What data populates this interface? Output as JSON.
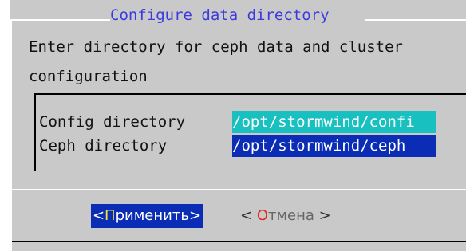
{
  "dialog": {
    "title": "Configure data directory",
    "prompt": "Enter directory for ceph data and cluster configuration"
  },
  "fields": [
    {
      "label": "Config directory",
      "value": "/opt/stormwind/confi"
    },
    {
      "label": "Ceph directory",
      "value": "/opt/stormwind/ceph"
    }
  ],
  "buttons": {
    "apply": {
      "left_bracket": "<",
      "hotkey": "П",
      "rest": "рименить",
      "right_bracket": ">"
    },
    "cancel": {
      "left_bracket": "< ",
      "hotkey": "О",
      "rest": "тмена",
      "right_bracket": " >"
    }
  },
  "colors": {
    "dialog_background": "#c9c9c9",
    "title": "#3a3ae0",
    "field_inactive_bg": "#19c0c0",
    "field_active_bg": "#0b2db5",
    "button_active_bg": "#0b2db5",
    "hotkey_active": "#f2e23a",
    "hotkey_inactive": "#e02a1a"
  }
}
